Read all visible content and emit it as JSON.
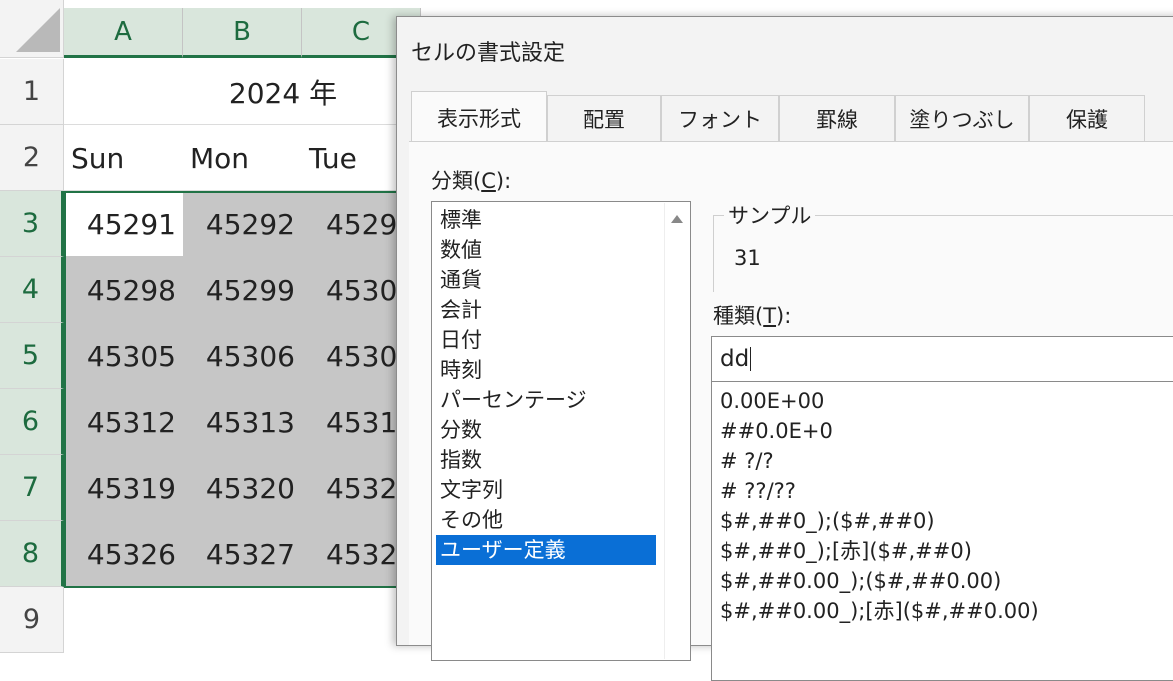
{
  "sheet": {
    "columns": [
      "A",
      "B",
      "C"
    ],
    "rows": [
      "1",
      "2",
      "3",
      "4",
      "5",
      "6",
      "7",
      "8",
      "9"
    ],
    "title_cell": "2024 年",
    "weekdays": [
      "Sun",
      "Mon",
      "Tue"
    ],
    "values": [
      [
        "45291",
        "45292",
        "4529"
      ],
      [
        "45298",
        "45299",
        "4530"
      ],
      [
        "45305",
        "45306",
        "4530"
      ],
      [
        "45312",
        "45313",
        "4531"
      ],
      [
        "45319",
        "45320",
        "4532"
      ],
      [
        "45326",
        "45327",
        "4532"
      ]
    ]
  },
  "dialog": {
    "title": "セルの書式設定",
    "tabs": [
      "表示形式",
      "配置",
      "フォント",
      "罫線",
      "塗りつぶし",
      "保護"
    ],
    "active_tab": "表示形式",
    "category_label": "分類(",
    "category_label_key": "C",
    "category_label_end": "):",
    "categories": [
      "標準",
      "数値",
      "通貨",
      "会計",
      "日付",
      "時刻",
      "パーセンテージ",
      "分数",
      "指数",
      "文字列",
      "その他",
      "ユーザー定義"
    ],
    "selected_category": "ユーザー定義",
    "sample_label": "サンプル",
    "sample_value": "31",
    "type_label": "種類(",
    "type_label_key": "T",
    "type_label_end": "):",
    "type_value": "dd",
    "formats": [
      "0.00E+00",
      "##0.0E+0",
      "# ?/?",
      "# ??/??",
      "$#,##0_);($#,##0)",
      "$#,##0_);[赤]($#,##0)",
      "$#,##0.00_);($#,##0.00)",
      "$#,##0.00_);[赤]($#,##0.00)"
    ]
  },
  "colors": {
    "excel_green": "#217346",
    "selection_blue": "#0a6fd6",
    "range_gray": "#c6c6c6"
  }
}
